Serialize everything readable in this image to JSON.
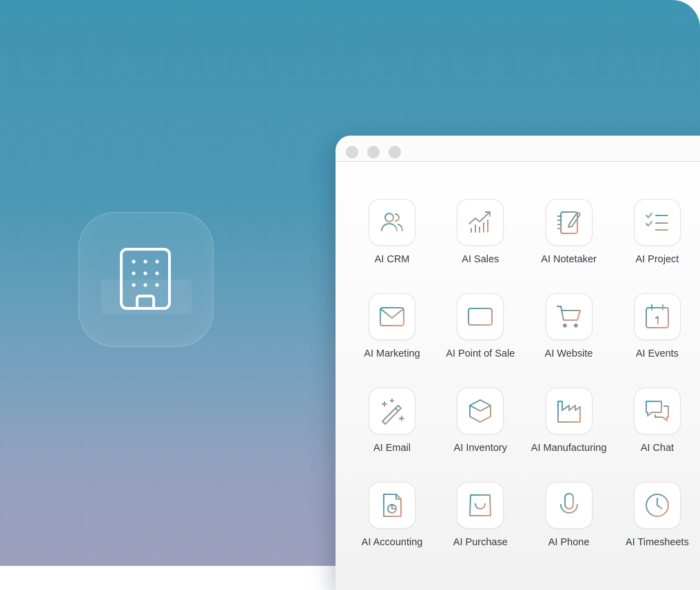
{
  "background": {
    "gradient_top": "#3b93b2",
    "gradient_bottom": "#9c9ebc"
  },
  "hero": {
    "icon": "building-icon"
  },
  "window": {
    "controls": [
      "close-dot",
      "minimize-dot",
      "maximize-dot"
    ],
    "apps": [
      {
        "label": "AI CRM",
        "icon": "contacts-icon"
      },
      {
        "label": "AI Sales",
        "icon": "chart-trend-icon"
      },
      {
        "label": "AI Notetaker",
        "icon": "notebook-pen-icon"
      },
      {
        "label": "AI Project",
        "icon": "checklist-icon"
      },
      {
        "label": "AI Marketing",
        "icon": "envelope-icon"
      },
      {
        "label": "AI Point of Sale",
        "icon": "credit-card-icon"
      },
      {
        "label": "AI Website",
        "icon": "shopping-cart-icon"
      },
      {
        "label": "AI Events",
        "icon": "calendar-icon"
      },
      {
        "label": "AI Email",
        "icon": "magic-wand-icon"
      },
      {
        "label": "AI Inventory",
        "icon": "box-icon"
      },
      {
        "label": "AI Manufacturing",
        "icon": "factory-icon"
      },
      {
        "label": "AI Chat",
        "icon": "chat-bubbles-icon"
      },
      {
        "label": "AI Accounting",
        "icon": "document-chart-icon"
      },
      {
        "label": "AI Purchase",
        "icon": "shopping-bag-icon"
      },
      {
        "label": "AI Phone",
        "icon": "microphone-icon"
      },
      {
        "label": "AI Timesheets",
        "icon": "clock-icon"
      }
    ]
  },
  "colors": {
    "icon_gradient_start": "#3c9db4",
    "icon_gradient_end": "#e89a7a"
  }
}
